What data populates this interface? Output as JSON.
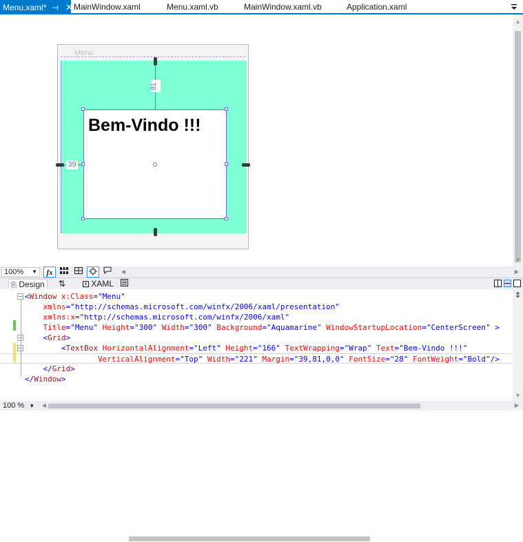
{
  "tabs": [
    {
      "label": "Menu.xaml*",
      "active": true
    },
    {
      "label": "MainWindow.xaml",
      "active": false
    },
    {
      "label": "Menu.xaml.vb",
      "active": false
    },
    {
      "label": "MainWindow.xaml.vb",
      "active": false
    },
    {
      "label": "Application.xaml",
      "active": false
    }
  ],
  "designer": {
    "window_title": "Menu",
    "window_background": "#7fffd4",
    "textbox_text": "Bem-Vindo !!!",
    "margin_top": "81",
    "margin_left": "39"
  },
  "zoom": {
    "design_zoom": "100%",
    "fx_label": "fx",
    "code_zoom": "100 %"
  },
  "split": {
    "design_label": "Design",
    "swap_icon": "⇅",
    "xaml_label": "XAML"
  },
  "code_lines": [
    [
      {
        "t": "<",
        "c": "t-br"
      },
      {
        "t": "Window",
        "c": "t-tag"
      },
      {
        "t": " x:Class",
        "c": "t-attr"
      },
      {
        "t": "=\"Menu\"",
        "c": "t-val"
      }
    ],
    [
      {
        "t": "    xmlns",
        "c": "t-attr"
      },
      {
        "t": "=\"http://schemas.microsoft.com/winfx/2006/xaml/presentation\"",
        "c": "t-val"
      }
    ],
    [
      {
        "t": "    xmlns:x",
        "c": "t-attr"
      },
      {
        "t": "=\"http://schemas.microsoft.com/winfx/2006/xaml\"",
        "c": "t-val"
      }
    ],
    [
      {
        "t": "    Title",
        "c": "t-attr"
      },
      {
        "t": "=\"Menu\"",
        "c": "t-val"
      },
      {
        "t": " Height",
        "c": "t-attr"
      },
      {
        "t": "=\"300\"",
        "c": "t-val"
      },
      {
        "t": " Width",
        "c": "t-attr"
      },
      {
        "t": "=\"300\"",
        "c": "t-val"
      },
      {
        "t": " Background",
        "c": "t-attr"
      },
      {
        "t": "=\"Aquamarine\"",
        "c": "t-val"
      },
      {
        "t": " WindowStartupLocation",
        "c": "t-attr"
      },
      {
        "t": "=\"CenterScreen\"",
        "c": "t-val"
      },
      {
        "t": " >",
        "c": "t-br"
      }
    ],
    [
      {
        "t": "    <",
        "c": "t-br"
      },
      {
        "t": "Grid",
        "c": "t-tag"
      },
      {
        "t": ">",
        "c": "t-br"
      }
    ],
    [
      {
        "t": "        <",
        "c": "t-br"
      },
      {
        "t": "TextBox",
        "c": "t-tag"
      },
      {
        "t": " HorizontalAlignment",
        "c": "t-attr"
      },
      {
        "t": "=\"Left\"",
        "c": "t-val"
      },
      {
        "t": " Height",
        "c": "t-attr"
      },
      {
        "t": "=\"166\"",
        "c": "t-val"
      },
      {
        "t": " TextWrapping",
        "c": "t-attr"
      },
      {
        "t": "=\"Wrap\"",
        "c": "t-val"
      },
      {
        "t": " Text",
        "c": "t-attr"
      },
      {
        "t": "=\"Bem-Vindo !!!\"",
        "c": "t-val"
      }
    ],
    [
      {
        "t": "                VerticalAlignment",
        "c": "t-attr"
      },
      {
        "t": "=\"Top\"",
        "c": "t-val"
      },
      {
        "t": " Width",
        "c": "t-attr"
      },
      {
        "t": "=\"221\"",
        "c": "t-val"
      },
      {
        "t": " Margin",
        "c": "t-attr"
      },
      {
        "t": "=\"39,81,0,0\"",
        "c": "t-val"
      },
      {
        "t": " FontSize",
        "c": "t-attr"
      },
      {
        "t": "=\"28\"",
        "c": "t-val"
      },
      {
        "t": " FontWeight",
        "c": "t-attr"
      },
      {
        "t": "=\"Bold\"",
        "c": "t-val"
      },
      {
        "t": "/>",
        "c": "t-br"
      }
    ],
    [
      {
        "t": "    </",
        "c": "t-br"
      },
      {
        "t": "Grid",
        "c": "t-tag"
      },
      {
        "t": ">",
        "c": "t-br"
      }
    ],
    [
      {
        "t": "</",
        "c": "t-br"
      },
      {
        "t": "Window",
        "c": "t-tag"
      },
      {
        "t": ">",
        "c": "t-br"
      }
    ]
  ],
  "colors": {
    "accent": "#007acc",
    "selection": "#6b6bd6",
    "changed_saved": "#6ac259",
    "changed_unsaved": "#efe470"
  }
}
